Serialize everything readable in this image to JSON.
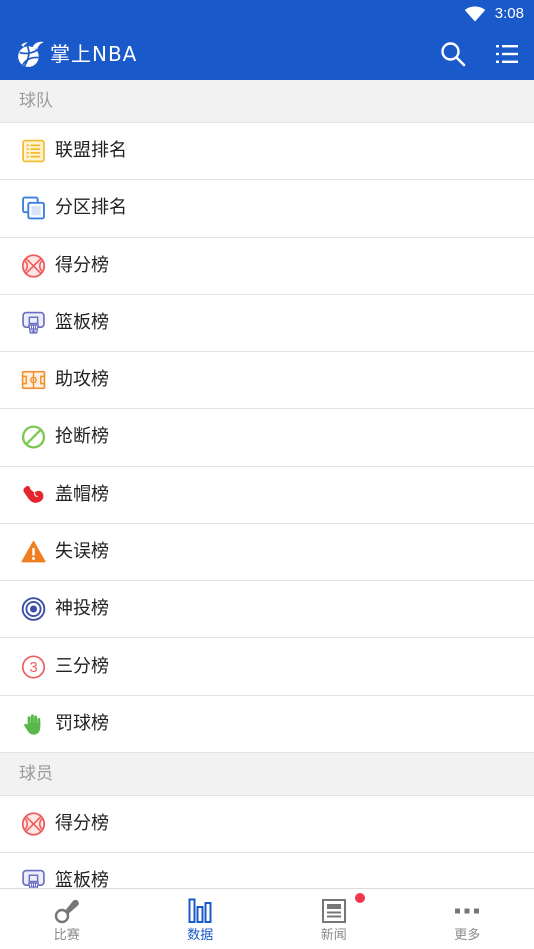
{
  "status_bar": {
    "time": "3:08",
    "icons": [
      "wifi-icon"
    ]
  },
  "app_bar": {
    "title": "掌上NBA",
    "logo_icon": "nba-logo-icon",
    "actions": [
      {
        "icon": "search-icon"
      },
      {
        "icon": "menu-list-icon"
      }
    ]
  },
  "sections": [
    {
      "title": "球队",
      "items": [
        {
          "label": "联盟排名",
          "icon": "league-standings-icon"
        },
        {
          "label": "分区排名",
          "icon": "division-standings-icon"
        },
        {
          "label": "得分榜",
          "icon": "basketball-icon"
        },
        {
          "label": "篮板榜",
          "icon": "hoop-icon"
        },
        {
          "label": "助攻榜",
          "icon": "court-icon"
        },
        {
          "label": "抢断榜",
          "icon": "no-entry-icon"
        },
        {
          "label": "盖帽榜",
          "icon": "flexed-arm-icon"
        },
        {
          "label": "失误榜",
          "icon": "warning-icon"
        },
        {
          "label": "神投榜",
          "icon": "target-icon"
        },
        {
          "label": "三分榜",
          "icon": "circled-three-icon",
          "icon_text": "3"
        },
        {
          "label": "罚球榜",
          "icon": "hand-icon"
        }
      ]
    },
    {
      "title": "球员",
      "items": [
        {
          "label": "得分榜",
          "icon": "basketball-icon"
        },
        {
          "label": "篮板榜",
          "icon": "hoop-icon"
        }
      ]
    }
  ],
  "bottom_nav": {
    "items": [
      {
        "label": "比赛",
        "icon": "whistle-icon",
        "active": false
      },
      {
        "label": "数据",
        "icon": "bar-chart-icon",
        "active": true
      },
      {
        "label": "新闻",
        "icon": "newspaper-icon",
        "active": false,
        "badge": true
      },
      {
        "label": "更多",
        "icon": "more-dots-icon",
        "active": false
      }
    ]
  },
  "colors": {
    "primary": "#1a59c9",
    "section_bg": "#f2f2f2",
    "divider": "#e3e3e3",
    "text": "#222222",
    "muted": "#9b9b9b",
    "inactive": "#8a8a8a",
    "badge": "#f0364f"
  }
}
